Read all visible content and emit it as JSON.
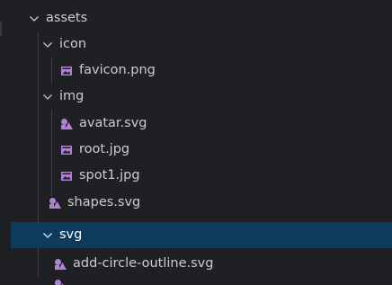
{
  "colors": {
    "background": "#1f2023",
    "selected_row": "#0e3a5c",
    "icon_purple": "#b180d7",
    "text": "#cccccc"
  },
  "tree": {
    "assets": {
      "label": "assets",
      "expanded": true
    },
    "icon": {
      "label": "icon",
      "expanded": true
    },
    "favicon": {
      "label": "favicon.png",
      "icon": "image-file-icon"
    },
    "img": {
      "label": "img",
      "expanded": true
    },
    "avatar": {
      "label": "avatar.svg",
      "icon": "svg-file-icon"
    },
    "root": {
      "label": "root.jpg",
      "icon": "image-file-icon"
    },
    "spot1": {
      "label": "spot1.jpg",
      "icon": "image-file-icon"
    },
    "shapes": {
      "label": "shapes.svg",
      "icon": "svg-file-icon"
    },
    "svg": {
      "label": "svg",
      "expanded": true,
      "selected": true
    },
    "add_circle_outline": {
      "label": "add-circle-outline.svg",
      "icon": "svg-file-icon"
    }
  }
}
